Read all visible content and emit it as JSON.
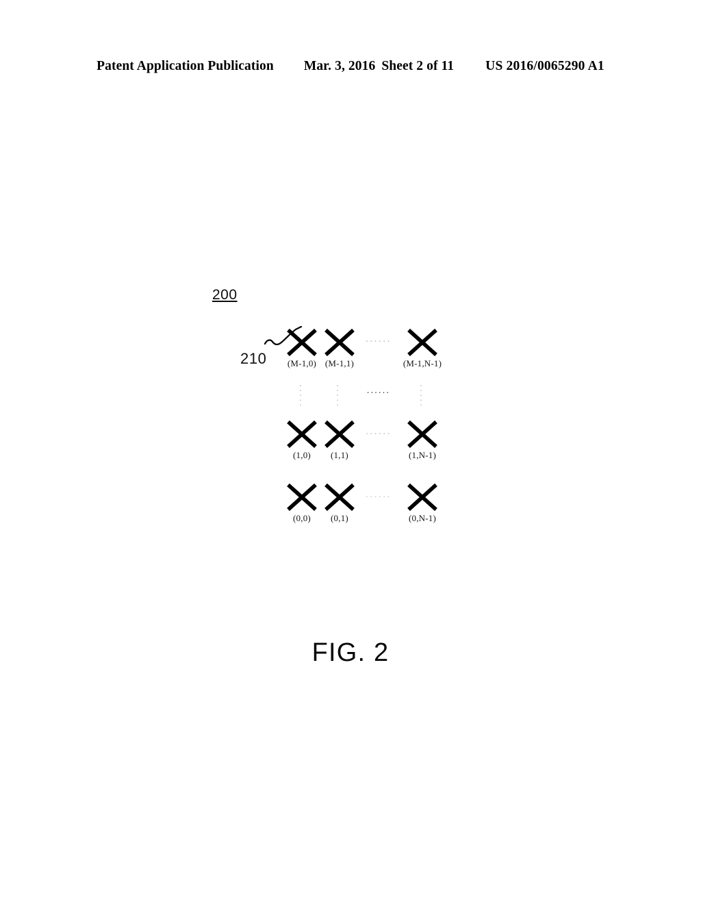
{
  "header": {
    "publication": "Patent Application Publication",
    "date": "Mar. 3, 2016",
    "sheet": "Sheet 2 of 11",
    "document_number": "US 2016/0065290 A1"
  },
  "figure": {
    "caption": "FIG. 2",
    "reference_numeral": "200",
    "callout": {
      "numeral": "210",
      "points_to": "cell-M-1-0"
    },
    "ellipsis_glyph": "......",
    "vertical_ellipsis_dots": [
      ".",
      ".",
      ".",
      ".",
      "."
    ],
    "array": {
      "rows": [
        {
          "row_id": "row-top",
          "cells": [
            {
              "label": "(M-1,0)",
              "icon": "x-mark"
            },
            {
              "label": "(M-1,1)",
              "icon": "x-mark"
            },
            {
              "label": "(M-1,N-1)",
              "icon": "x-mark"
            }
          ]
        },
        {
          "row_id": "row-mid",
          "cells": [
            {
              "label": "(1,0)",
              "icon": "x-mark"
            },
            {
              "label": "(1,1)",
              "icon": "x-mark"
            },
            {
              "label": "(1,N-1)",
              "icon": "x-mark"
            }
          ]
        },
        {
          "row_id": "row-bottom",
          "cells": [
            {
              "label": "(0,0)",
              "icon": "x-mark"
            },
            {
              "label": "(0,1)",
              "icon": "x-mark"
            },
            {
              "label": "(0,N-1)",
              "icon": "x-mark"
            }
          ]
        }
      ]
    }
  },
  "colors": {
    "ink": "#000000",
    "page": "#ffffff",
    "ellipsis_light": "#b8b8b8"
  }
}
